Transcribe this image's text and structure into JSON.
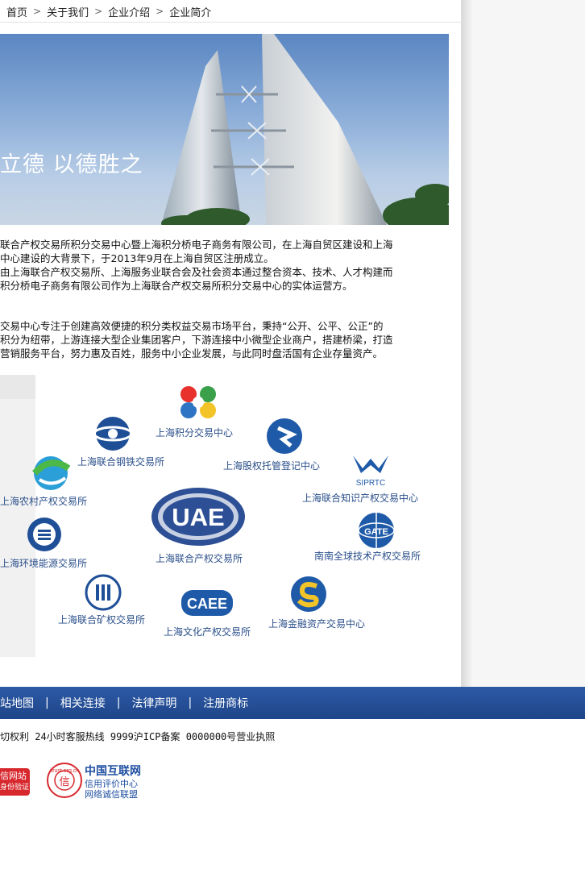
{
  "breadcrumb": {
    "items": [
      "首页",
      "关于我们",
      "企业介绍",
      "企业简介"
    ],
    "separator": ">"
  },
  "banner": {
    "slogan": "立德  以德胜之"
  },
  "intro": {
    "p1_line1": "联合产权交易所积分交易中心暨上海积分桥电子商务有限公司，在上海自贸区建设和上海",
    "p1_line2": "中心建设的大背景下，于2013年9月在上海自贸区注册成立。",
    "p1_line3": "由上海联合产权交易所、上海服务业联合会及社会资本通过整合资本、技术、人才构建而",
    "p1_line4": "积分桥电子商务有限公司作为上海联合产权交易所积分交易中心的实体运营方。",
    "p2_line1": "交易中心专注于创建高效便捷的积分类权益交易市场平台，秉持“公开、公平、公正”的",
    "p2_line2": "积分为纽带，上游连接大型企业集团客户，下游连接中小微型企业商户，搭建桥梁，打造",
    "p2_line3": "营销服务平台，努力惠及百姓，服务中小企业发展，与此同时盘活国有企业存量资产。"
  },
  "partners": [
    {
      "name": "上海积分交易中心",
      "icon": "four-petal-logo-icon"
    },
    {
      "name": "上海联合钢铁交易所",
      "icon": "steel-exchange-logo-icon"
    },
    {
      "name": "上海股权托管登记中心",
      "icon": "equity-custody-logo-icon"
    },
    {
      "name": "上海农村产权交易所",
      "icon": "rural-exchange-logo-icon"
    },
    {
      "name": "上海联合知识产权交易中心",
      "icon": "siprtc-logo-icon",
      "mark": "SIPRTC"
    },
    {
      "name": "上海联合产权交易所",
      "icon": "uae-logo-icon",
      "mark": "UAE"
    },
    {
      "name": "上海环境能源交易所",
      "icon": "energy-exchange-logo-icon"
    },
    {
      "name": "南南全球技术产权交易所",
      "icon": "gate-logo-icon",
      "mark": "GATE"
    },
    {
      "name": "上海联合矿权交易所",
      "icon": "mining-exchange-logo-icon"
    },
    {
      "name": "上海文化产权交易所",
      "icon": "caee-logo-icon",
      "mark": "CAEE"
    },
    {
      "name": "上海金融资产交易中心",
      "icon": "financial-asset-logo-icon"
    }
  ],
  "footer": {
    "links": [
      "站地图",
      "相关连接",
      "法律声明",
      "注册商标"
    ],
    "separator": "|",
    "copyright": "切权利 24小时客服热线 9999沪ICP备案 0000000号营业执照"
  },
  "badges": {
    "badge1_line1": "信网站",
    "badge1_line2": "身份验证",
    "badge2_title": "中国互联网",
    "badge2_line2": "信用评价中心",
    "badge2_line3": "网络诚信联盟",
    "badge2_seal_top": "itrust.org.cn",
    "badge2_seal_center": "信"
  },
  "colors": {
    "footer_bar": "#2350a0",
    "partner_text": "#2a4f8a"
  }
}
